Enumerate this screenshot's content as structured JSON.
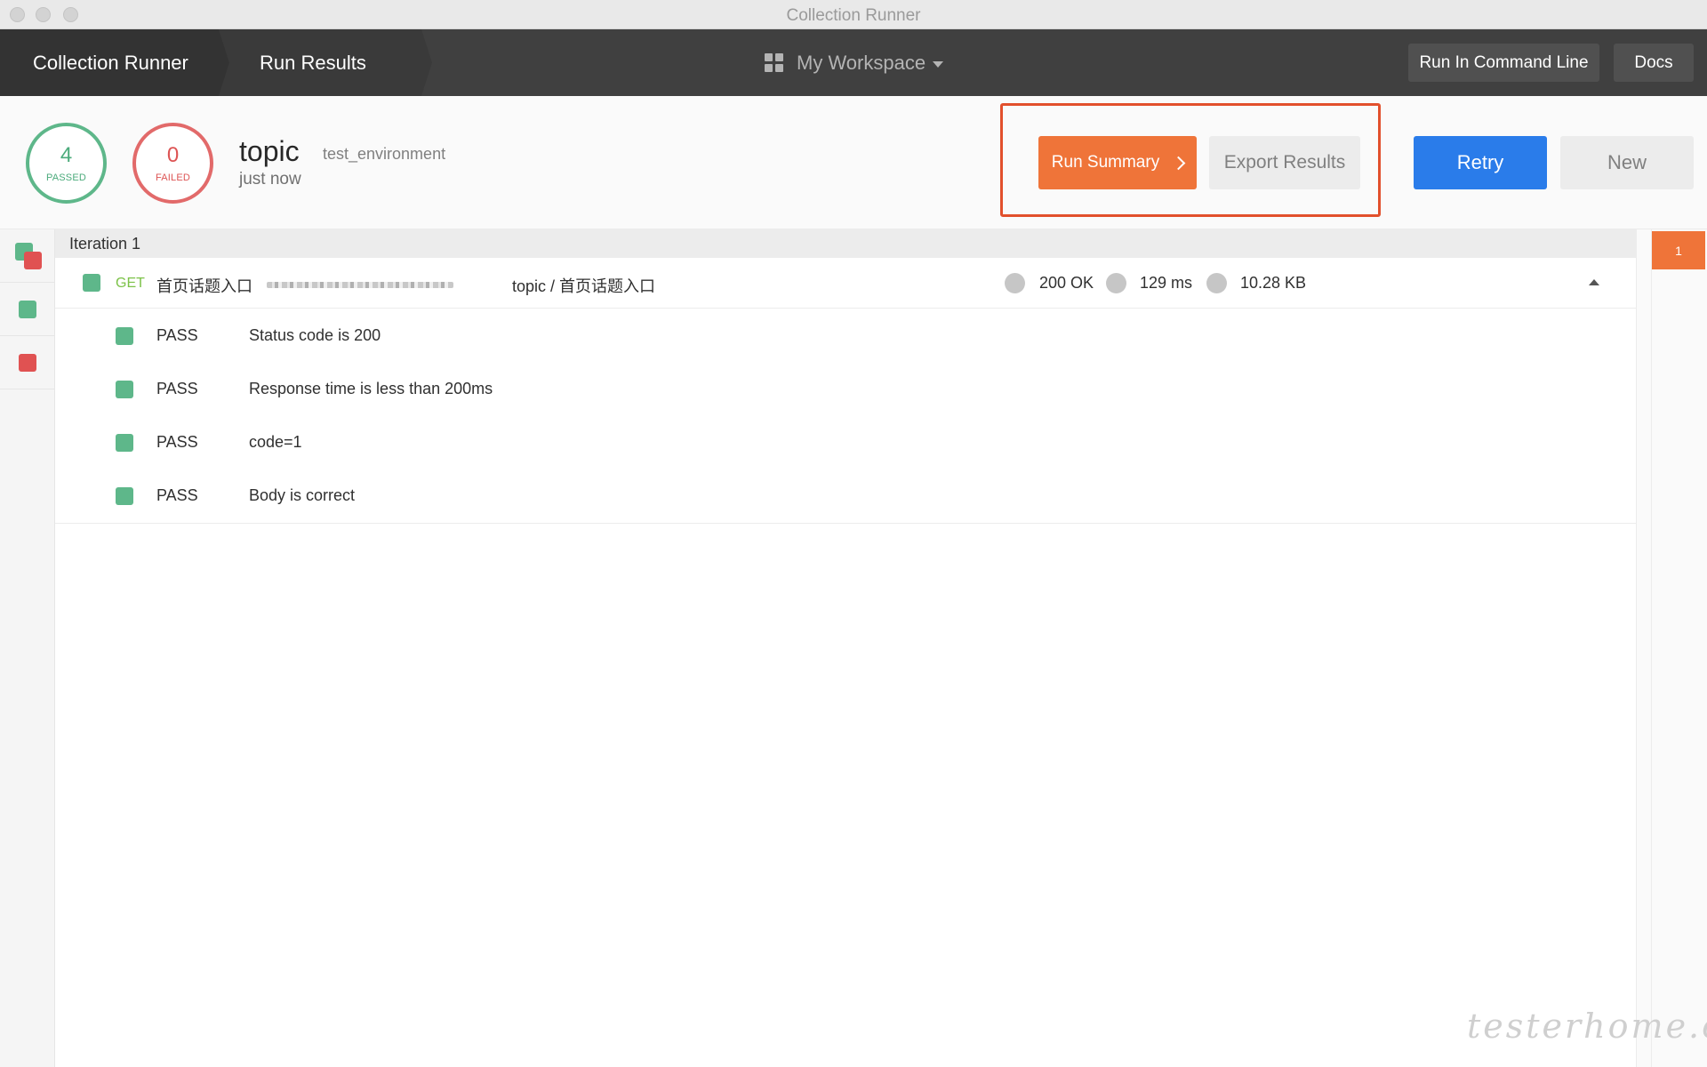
{
  "window": {
    "title": "Collection Runner"
  },
  "nav": {
    "crumbs": [
      "Collection Runner",
      "Run Results"
    ],
    "workspace": {
      "label": "My Workspace",
      "icon": "grid-icon"
    },
    "buttons": {
      "command_line": "Run In Command Line",
      "docs": "Docs"
    }
  },
  "summary": {
    "passed": {
      "count": "4",
      "label": "PASSED",
      "color": "#5eb78a"
    },
    "failed": {
      "count": "0",
      "label": "FAILED",
      "color": "#e26a6a"
    },
    "collection_name": "topic",
    "environment": "test_environment",
    "run_time": "just now",
    "buttons": {
      "run_summary": "Run Summary",
      "export_results": "Export Results",
      "retry": "Retry",
      "new": "New"
    },
    "colors": {
      "accent_orange": "#ef7439",
      "retry_blue": "#2a7cea",
      "highlight_red": "#e2502c"
    }
  },
  "results": {
    "iteration_label": "Iteration 1",
    "request": {
      "method": "GET",
      "name": "首页话题入口",
      "path": "topic / 首页话题入口",
      "status": "200 OK",
      "time": "129 ms",
      "size": "10.28 KB"
    },
    "tests": [
      {
        "result": "PASS",
        "name": "Status code is 200"
      },
      {
        "result": "PASS",
        "name": "Response time is less than 200ms"
      },
      {
        "result": "PASS",
        "name": "code=1"
      },
      {
        "result": "PASS",
        "name": "Body is correct"
      }
    ]
  },
  "iterations_strip": {
    "current": "1"
  },
  "watermark": "testerhome.com"
}
